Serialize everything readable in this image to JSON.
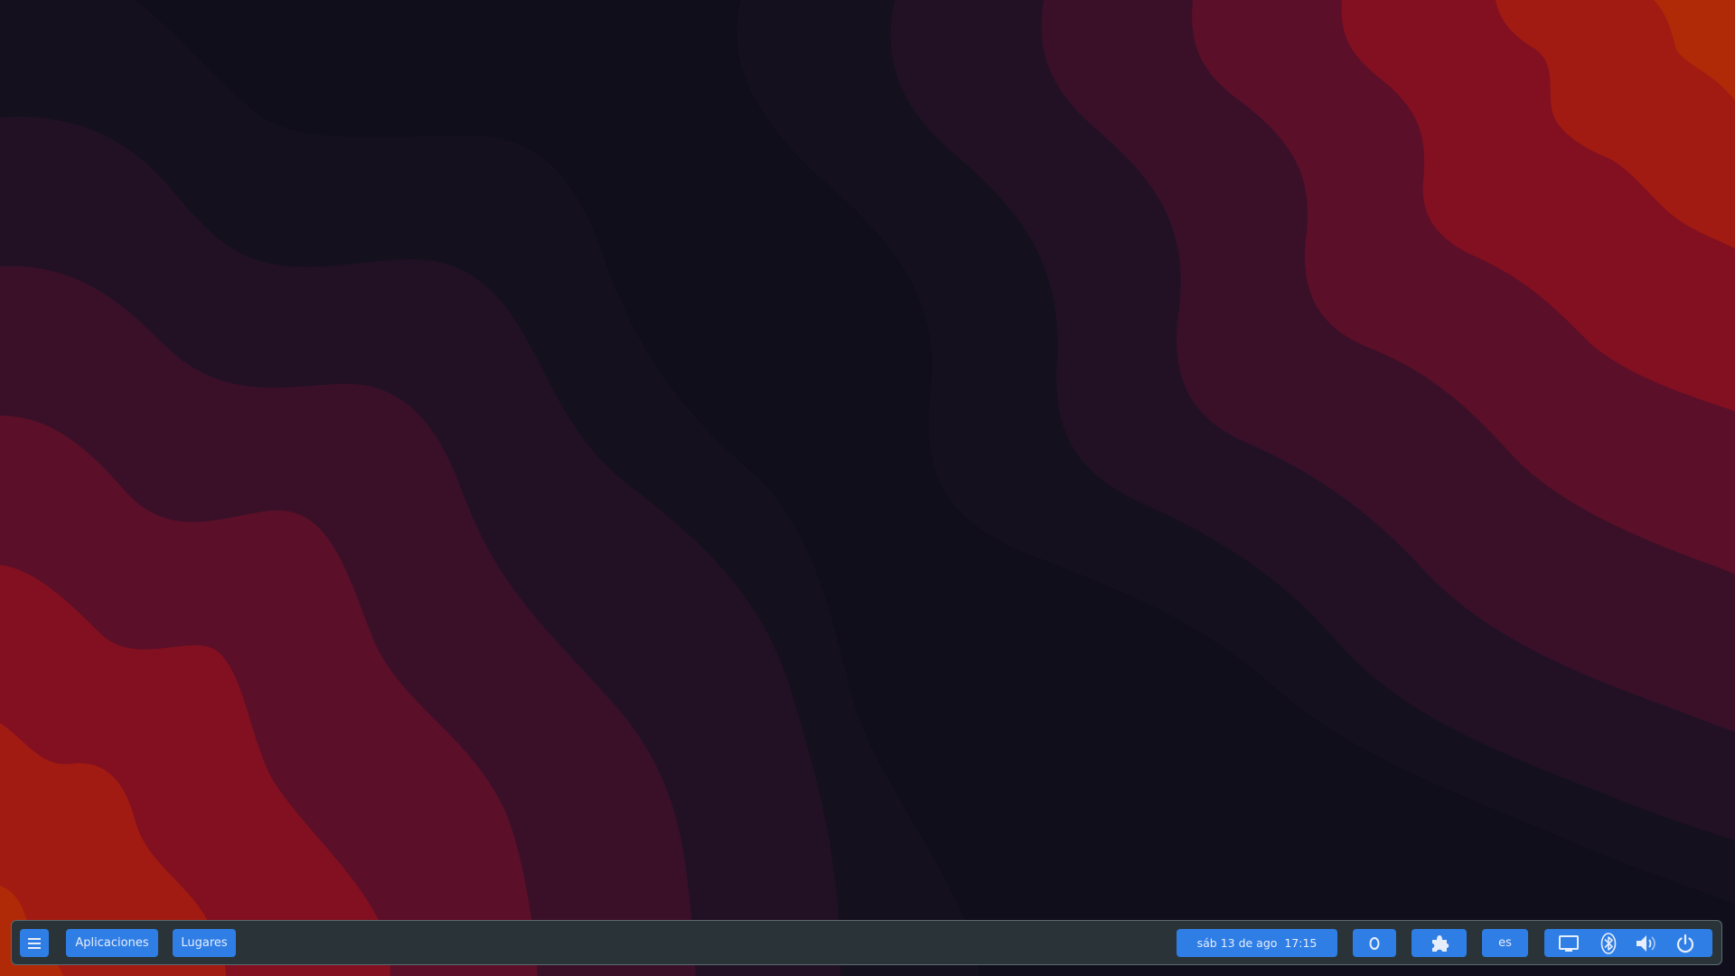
{
  "colors": {
    "panel_background": "#2a3438",
    "panel_border": "#5c6a6f",
    "button_accent": "#2f7ee6",
    "button_text": "#e6eefb",
    "wallpaper_bands": [
      "#0f0e1a",
      "#15101e",
      "#221125",
      "#3a1029",
      "#5c0f28",
      "#821021",
      "#a21b12",
      "#b02a08"
    ]
  },
  "wallpaper": {
    "name": "wavy-gradient-wallpaper"
  },
  "panel": {
    "menu_icon": "hamburger-menu-icon",
    "applications_label": "Aplicaciones",
    "places_label": "Lugares",
    "datetime": "sáb 13 de ago  17:15",
    "indicator_icon": "circle-zero-icon",
    "extensions_icon": "puzzle-piece-icon",
    "keyboard_layout": "es",
    "system_tray": [
      {
        "name": "screen-icon"
      },
      {
        "name": "bluetooth-icon"
      },
      {
        "name": "volume-icon"
      },
      {
        "name": "power-icon"
      }
    ]
  }
}
